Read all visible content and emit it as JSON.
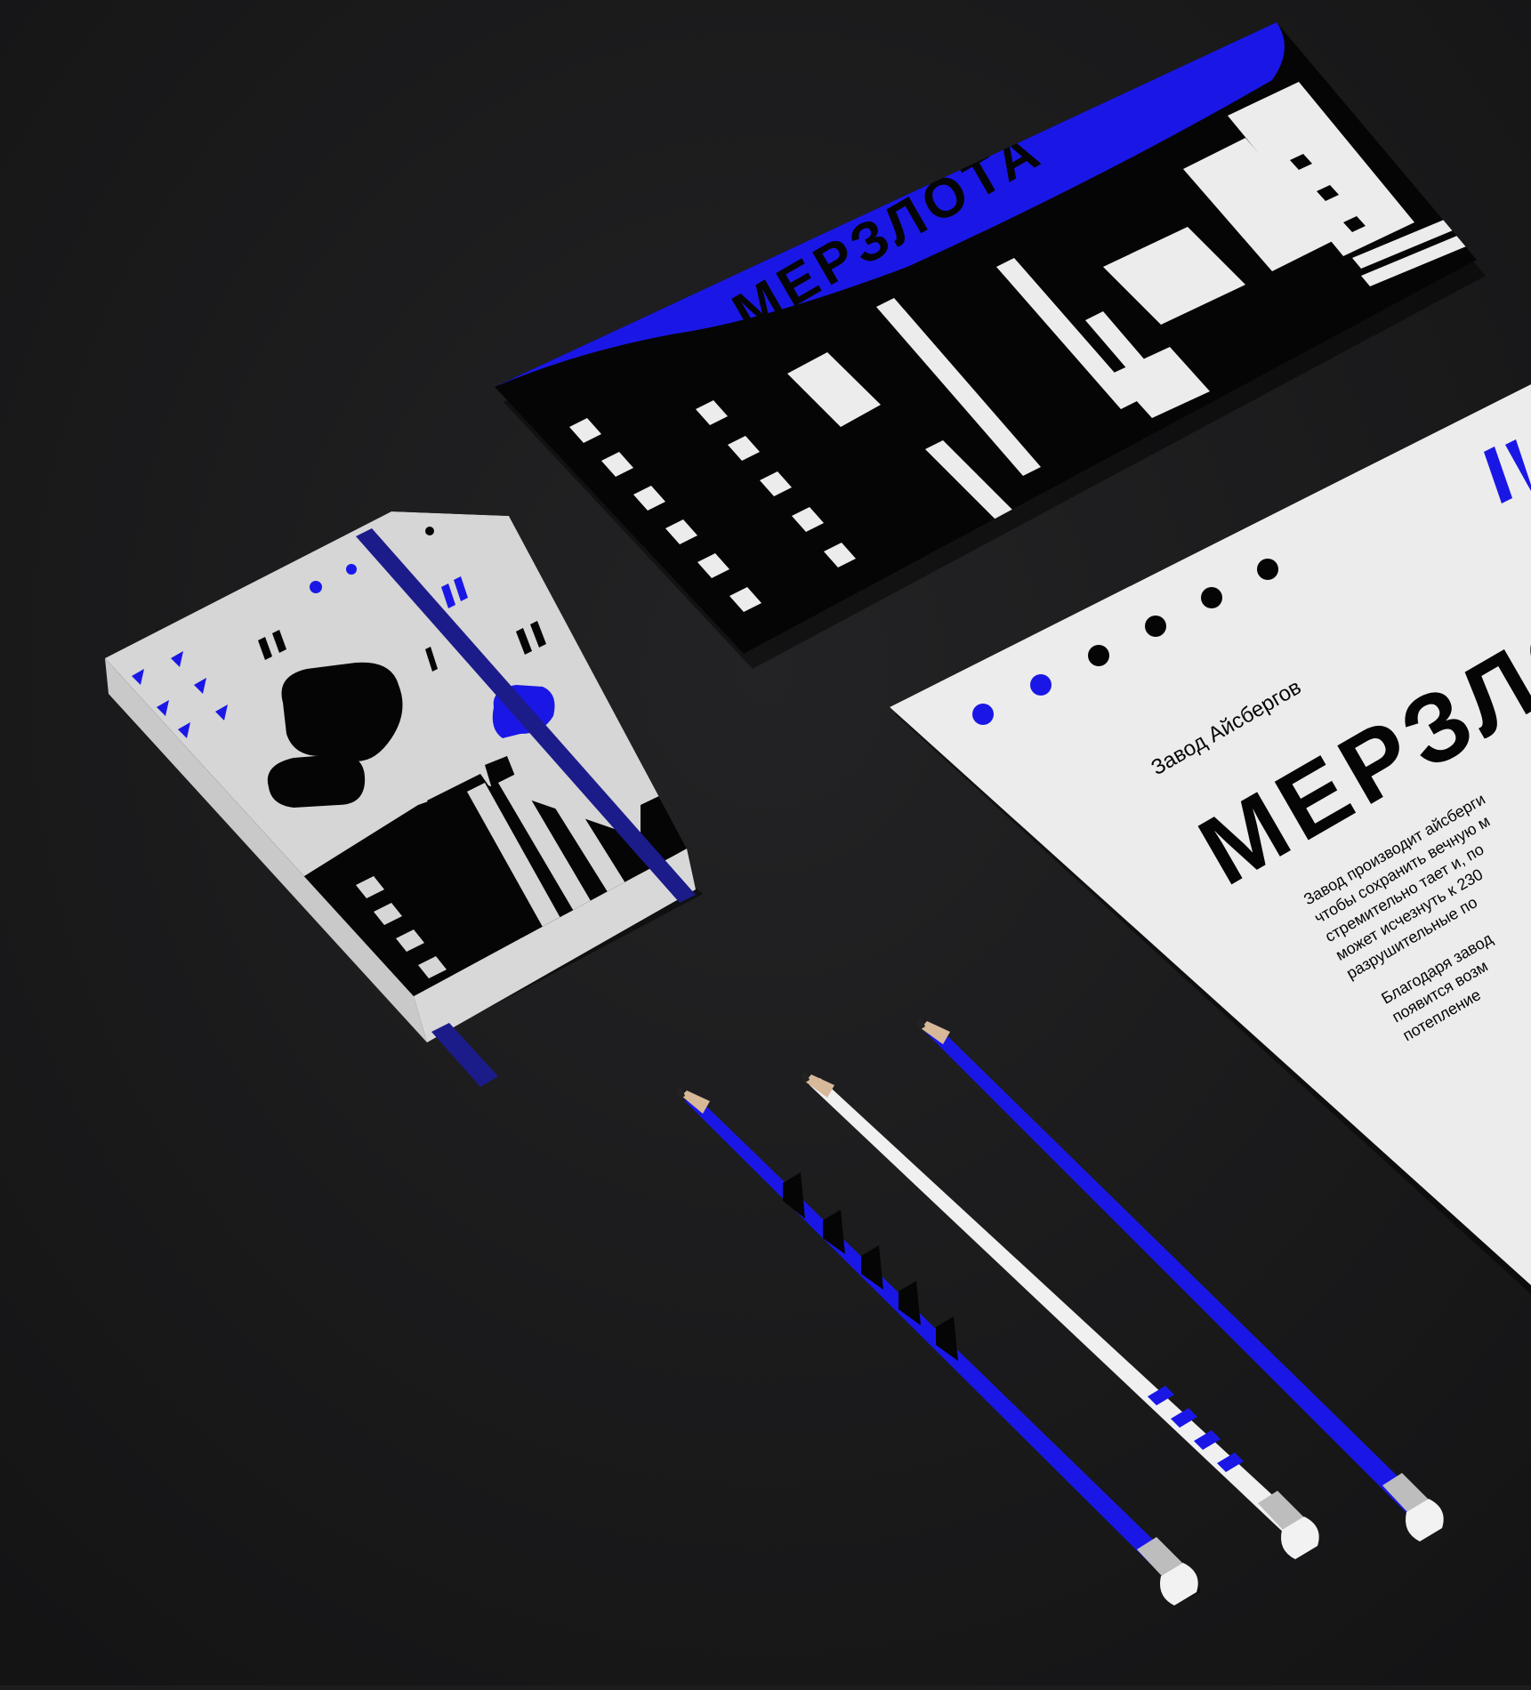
{
  "scene": {
    "colors": {
      "background": "#1d1d1f",
      "accent_blue": "#1a17e6",
      "paper": "#ececec",
      "ink": "#050505",
      "elastic": "#1c1b8a"
    }
  },
  "envelope": {
    "flap_wordmark": "МЕРЗЛОТА"
  },
  "letterhead": {
    "subtitle": "Завод Айсбергов",
    "wordmark": "МЕРЗЛОТА",
    "body_lines": [
      "Завод производит айсберги",
      "чтобы сохранить вечную м",
      "стремительно тает и, по",
      "может исчезнуть к 230",
      "разрушительные по"
    ],
    "body_lines_2": [
      "Благодаря завод",
      "появится возм",
      "потепление"
    ]
  },
  "notebook": {},
  "pencils": [
    {
      "color": "blue-black-pattern"
    },
    {
      "color": "white-blue-stripes"
    },
    {
      "color": "solid-blue"
    }
  ]
}
